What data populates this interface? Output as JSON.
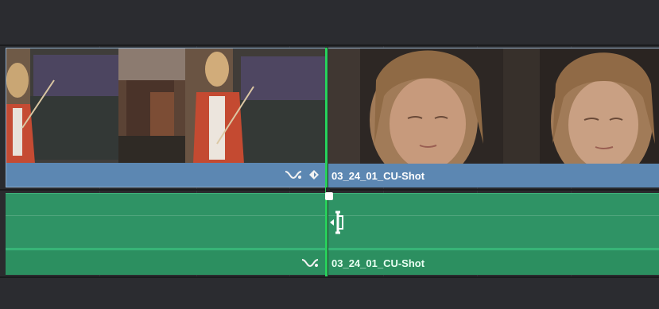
{
  "timeline": {
    "video_track": {
      "clips": [
        {
          "label": "",
          "side": "left"
        },
        {
          "label": "03_24_01_CU-Shot",
          "side": "right"
        }
      ]
    },
    "audio_track": {
      "clips": [
        {
          "label": "",
          "side": "left"
        },
        {
          "label": "03_24_01_CU-Shot",
          "side": "right"
        }
      ]
    }
  },
  "icons": {
    "curve": "curve-icon",
    "keyframe": "keyframe-icon",
    "trim_cursor": "trim-cursor-icon"
  },
  "colors": {
    "video_clip": "#5d8bb6",
    "audio_clip": "#2f9365",
    "edit_point": "#27d25b"
  }
}
